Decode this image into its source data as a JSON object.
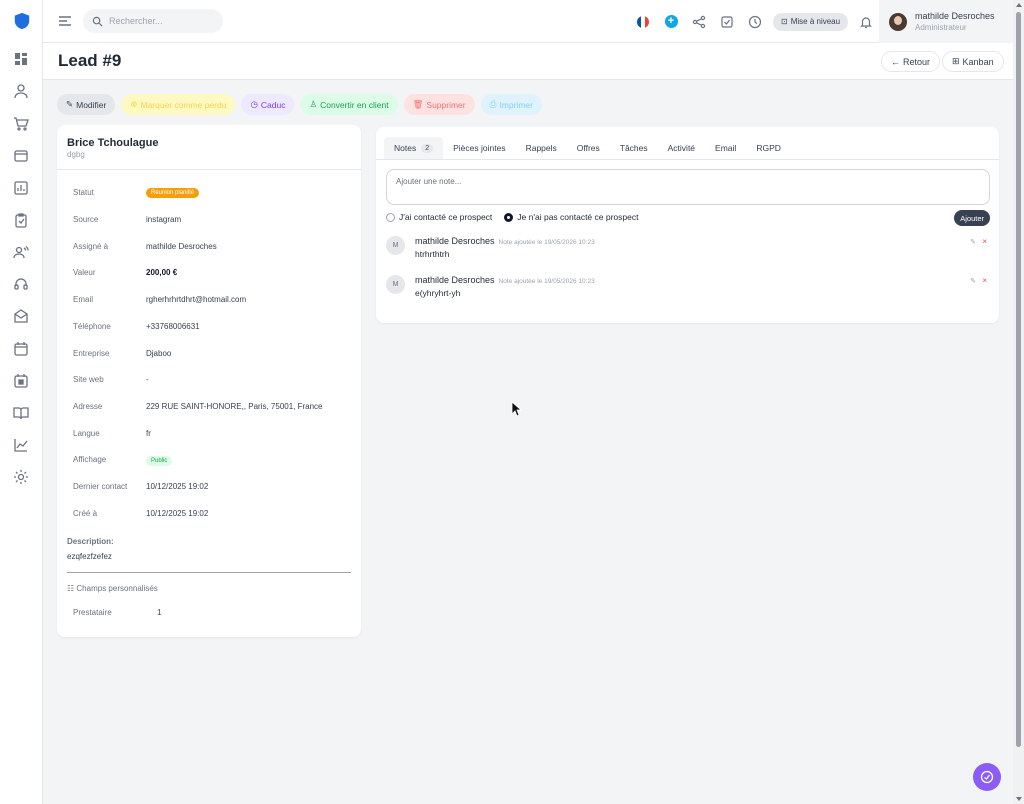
{
  "search": {
    "placeholder": "Rechercher..."
  },
  "topbar": {
    "upgrade_label": "Mise à niveau",
    "flag_colors": [
      "#0055a4",
      "#ffffff",
      "#ef4135"
    ]
  },
  "user": {
    "name": "mathilde Desroches",
    "role": "Administrateur"
  },
  "page": {
    "title": "Lead #9",
    "back_label": "Retour",
    "kanban_label": "Kanban"
  },
  "actions": [
    {
      "label": "Modifier",
      "icon": "pencil-icon"
    },
    {
      "label": "Marquer comme perdu",
      "icon": "x-circle-icon"
    },
    {
      "label": "Caduc",
      "icon": "clock-icon"
    },
    {
      "label": "Convertir en client",
      "icon": "user-icon"
    },
    {
      "label": "Supprimer",
      "icon": "trash-icon"
    },
    {
      "label": "Imprimer",
      "icon": "printer-icon"
    }
  ],
  "lead": {
    "name": "Brice Tchoulague",
    "subtitle": "dgbg",
    "fields": [
      {
        "label": "Statut",
        "value": "Réunion planifié",
        "type": "badge-orange"
      },
      {
        "label": "Source",
        "value": "instagram"
      },
      {
        "label": "Assigné à",
        "value": "mathilde Desroches"
      },
      {
        "label": "Valeur",
        "value": "200,00 €",
        "type": "bold"
      },
      {
        "label": "Email",
        "value": "rgherhrhrtdhrt@hotmail.com"
      },
      {
        "label": "Téléphone",
        "value": "+33768006631"
      },
      {
        "label": "Entreprise",
        "value": "Djaboo"
      },
      {
        "label": "Site web",
        "value": "-"
      },
      {
        "label": "Adresse",
        "value": "229 RUE SAINT-HONORE,, Paris, 75001, France"
      },
      {
        "label": "Langue",
        "value": "fr"
      },
      {
        "label": "Affichage",
        "value": "Public",
        "type": "badge-green"
      },
      {
        "label": "Dernier contact",
        "value": "10/12/2025 19:02"
      },
      {
        "label": "Créé à",
        "value": "10/12/2025 19:02"
      }
    ],
    "description_label": "Description:",
    "description": "ezqfezfzefez",
    "custom_fields_title": "Champs personnalisés",
    "custom_fields": [
      {
        "label": "Prestataire",
        "value": "1"
      }
    ]
  },
  "tabs": [
    {
      "label": "Notes",
      "badge": "2",
      "active": true
    },
    {
      "label": "Pièces jointes"
    },
    {
      "label": "Rappels"
    },
    {
      "label": "Offres"
    },
    {
      "label": "Tâches"
    },
    {
      "label": "Activité"
    },
    {
      "label": "Email"
    },
    {
      "label": "RGPD"
    }
  ],
  "notes": {
    "placeholder": "Ajouter une note...",
    "radio_contacted": "J'ai contacté ce prospect",
    "radio_not_contacted": "Je n'ai pas contacté ce prospect",
    "selected_radio": "not_contacted",
    "add_label": "Ajouter",
    "items": [
      {
        "initial": "M",
        "author": "mathilde Desroches",
        "meta": "Note ajoutée le 19/05/2026 10:23",
        "text": "htrhrthtrh"
      },
      {
        "initial": "M",
        "author": "mathilde Desroches",
        "meta": "Note ajoutée le 19/05/2026 10:23",
        "text": "e(yhryhrt-yh"
      }
    ]
  }
}
